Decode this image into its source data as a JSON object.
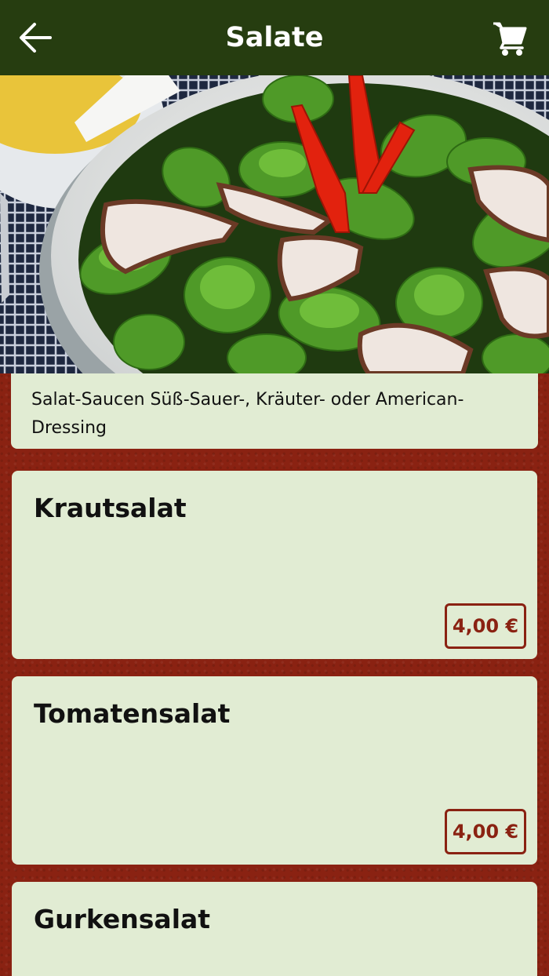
{
  "header": {
    "title": "Salate",
    "back_icon": "arrow-left-icon",
    "cart_icon": "shopping-cart-icon",
    "background_color": "#263d10"
  },
  "info": {
    "text": "Salat-Saucen Süß-Sauer-, Kräuter- oder American-Dressing"
  },
  "products": [
    {
      "name": "Krautsalat",
      "price": "4,00 €"
    },
    {
      "name": "Tomatensalat",
      "price": "4,00 €"
    },
    {
      "name": "Gurkensalat"
    }
  ],
  "colors": {
    "accent": "#8a2212",
    "card_background": "#e1ecd3",
    "page_background": "#8a2212"
  }
}
